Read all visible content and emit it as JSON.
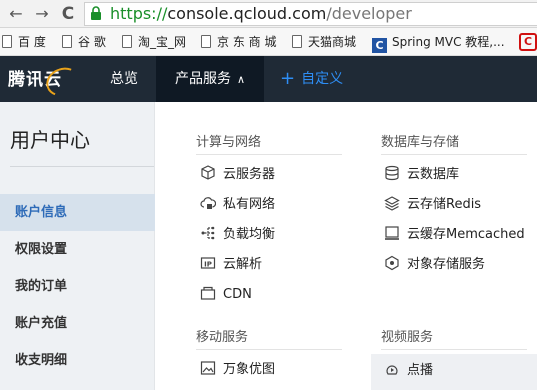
{
  "browser": {
    "url_scheme": "https://",
    "url_host": "console.qcloud.com",
    "url_path": "/developer",
    "back_glyph": "←",
    "forward_glyph": "→",
    "reload_glyph": "C"
  },
  "bookmarks": [
    {
      "label": "百 度",
      "icon": "doc-icon"
    },
    {
      "label": "谷 歌",
      "icon": "doc-icon"
    },
    {
      "label": "淘_宝_网",
      "icon": "doc-icon"
    },
    {
      "label": "京 东 商 城",
      "icon": "doc-icon"
    },
    {
      "label": "天猫商城",
      "icon": "doc-icon"
    },
    {
      "label": "Spring MVC 教程,...",
      "icon": "site-logo-icon"
    }
  ],
  "bookmark_logo_glyph": "C",
  "bookmark_overflow_glyph": "C",
  "header": {
    "logo": "腾讯云",
    "tabs": [
      {
        "label": "总览"
      },
      {
        "label": "产品服务",
        "caret": "∧"
      },
      {
        "label": "自定义",
        "prefix": "+"
      }
    ]
  },
  "sidebar": {
    "title": "用户中心",
    "items": [
      {
        "label": "账户信息",
        "active": true
      },
      {
        "label": "权限设置"
      },
      {
        "label": "我的订单"
      },
      {
        "label": "账户充值"
      },
      {
        "label": "收支明细"
      }
    ]
  },
  "products": {
    "compute": {
      "title": "计算与网络",
      "items": [
        "云服务器",
        "私有网络",
        "负载均衡",
        "云解析",
        "CDN"
      ]
    },
    "database": {
      "title": "数据库与存储",
      "items": [
        "云数据库",
        "云存储Redis",
        "云缓存Memcached",
        "对象存储服务"
      ]
    },
    "mobile": {
      "title": "移动服务",
      "items": [
        "万象优图"
      ]
    },
    "video": {
      "title": "视频服务",
      "items": [
        "点播"
      ]
    }
  },
  "colors": {
    "nav_bg": "#1f2a36",
    "accent": "#2e8ef5",
    "logo_accent": "#e9a21a",
    "sidebar_bg": "#eef1f4",
    "sidebar_active_bg": "#d6e1ec",
    "sidebar_active_text": "#2e6bb8"
  }
}
